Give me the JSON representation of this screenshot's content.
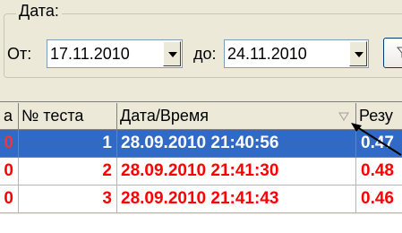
{
  "filter": {
    "group_title": "Дата:",
    "from_label": "От:",
    "from_value": "17.11.2010",
    "to_label": "до:",
    "to_value": "24.11.2010"
  },
  "grid": {
    "columns": [
      "а",
      "№ теста",
      "Дата/Время",
      "Резу"
    ],
    "rows": [
      {
        "mark": "0",
        "test_no": "1",
        "datetime": "28.09.2010 21:40:56",
        "result": "0.47",
        "selected": true
      },
      {
        "mark": "0",
        "test_no": "2",
        "datetime": "28.09.2010 21:41:30",
        "result": "0.48",
        "selected": false
      },
      {
        "mark": "0",
        "test_no": "3",
        "datetime": "28.09.2010 21:41:43",
        "result": "0.46",
        "selected": false
      }
    ]
  },
  "icons": {
    "dropdown": "chevron-down-icon",
    "sort": "sort-triangle-icon",
    "filter": "funnel-icon",
    "annotation": "arrow-annotation"
  },
  "colors": {
    "selection": "#316AC5",
    "row_text": "#FF0000",
    "window_bg": "#ECE9D8"
  }
}
